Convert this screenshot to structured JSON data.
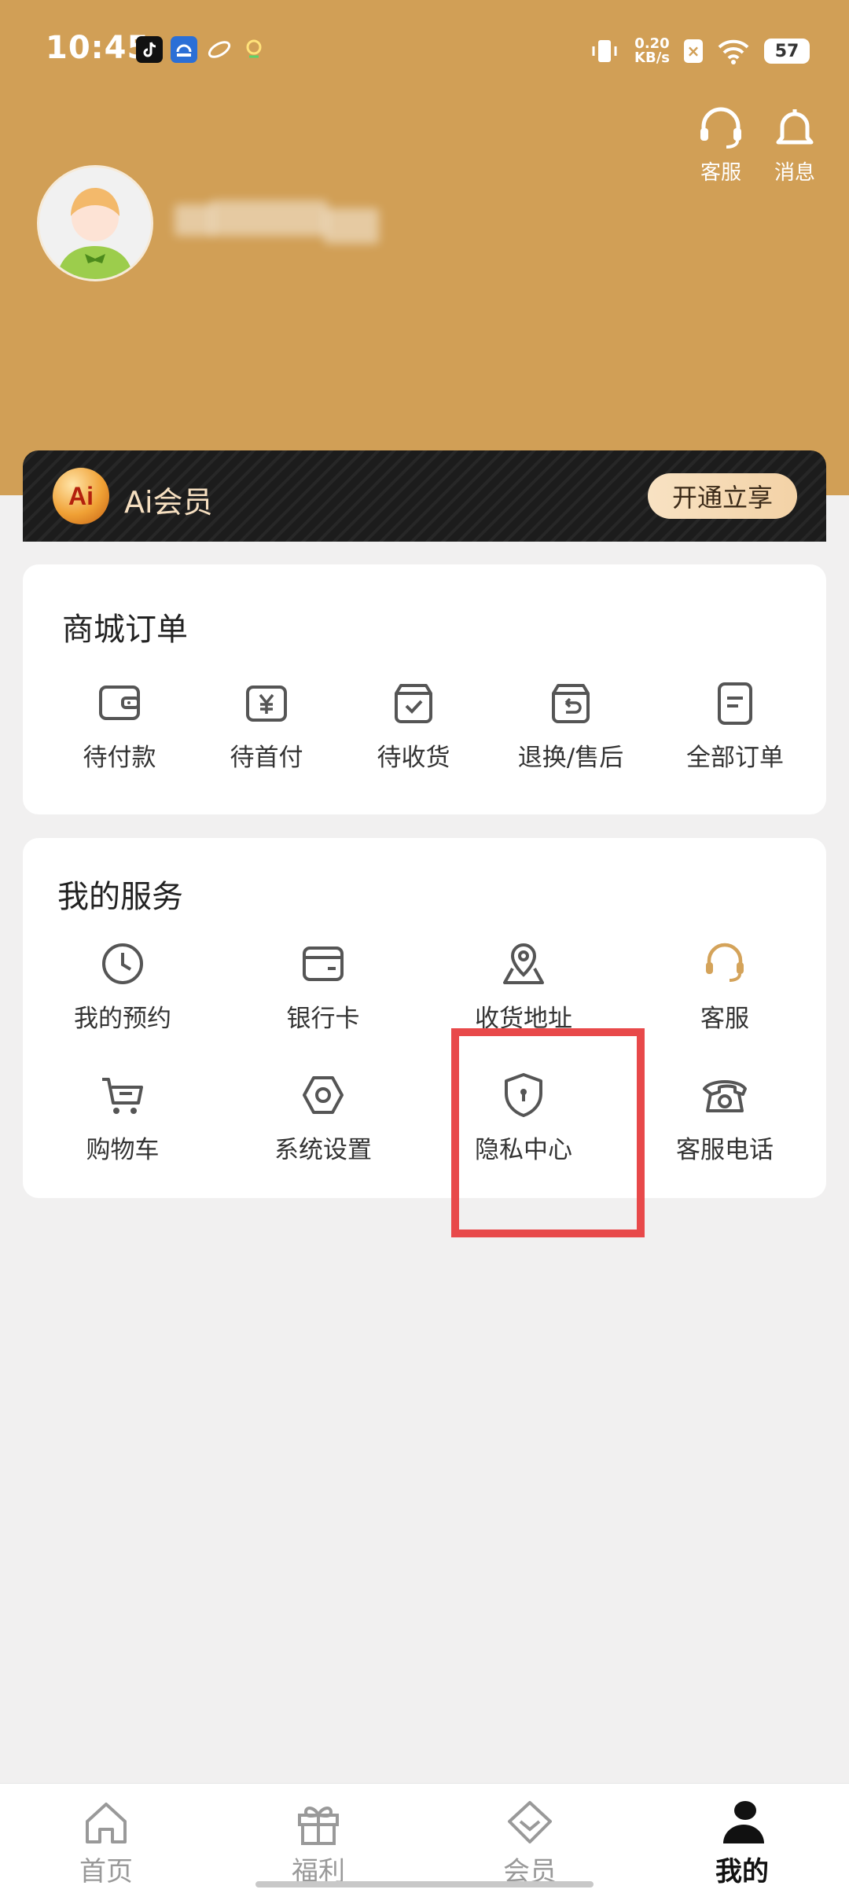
{
  "status_bar": {
    "time": "10:45",
    "net_speed_value": "0.20",
    "net_speed_unit": "KB/s",
    "battery": "57"
  },
  "header": {
    "customer_service_label": "客服",
    "messages_label": "消息"
  },
  "ai_banner": {
    "logo_text": "Ai",
    "title": "Ai会员",
    "button_label": "开通立享"
  },
  "orders": {
    "title": "商城订单",
    "items": [
      {
        "label": "待付款",
        "icon": "wallet-icon"
      },
      {
        "label": "待首付",
        "icon": "yen-icon"
      },
      {
        "label": "待收货",
        "icon": "box-check-icon"
      },
      {
        "label": "退换/售后",
        "icon": "return-box-icon"
      },
      {
        "label": "全部订单",
        "icon": "document-icon"
      }
    ]
  },
  "services": {
    "title": "我的服务",
    "items": [
      {
        "label": "我的预约",
        "icon": "clock-icon"
      },
      {
        "label": "银行卡",
        "icon": "card-icon"
      },
      {
        "label": "收货地址",
        "icon": "location-icon"
      },
      {
        "label": "客服",
        "icon": "headset-icon"
      },
      {
        "label": "购物车",
        "icon": "cart-icon"
      },
      {
        "label": "系统设置",
        "icon": "settings-hexagon-icon"
      },
      {
        "label": "隐私中心",
        "icon": "shield-lock-icon"
      },
      {
        "label": "客服电话",
        "icon": "telephone-icon"
      }
    ]
  },
  "bottom_nav": {
    "items": [
      {
        "label": "首页",
        "icon": "home-icon"
      },
      {
        "label": "福利",
        "icon": "gift-icon"
      },
      {
        "label": "会员",
        "icon": "diamond-icon"
      },
      {
        "label": "我的",
        "icon": "person-icon"
      }
    ],
    "active_index": 3
  },
  "colors": {
    "header_bg": "#d19f56",
    "highlight": "#e8494a",
    "gold_icon": "#d4a35a"
  }
}
